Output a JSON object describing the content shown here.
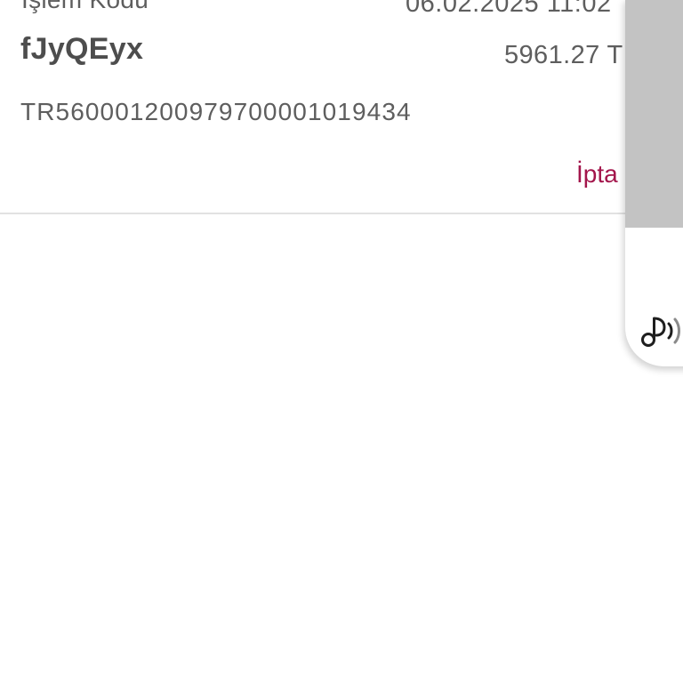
{
  "transaction": {
    "label_top": "İşlem Kodu",
    "date": "06.02.2025 11:02",
    "code": "fJyQEyx",
    "amount": "5961.27 T",
    "iban": "TR560001200979700001019434",
    "cancel_label": "İpta"
  },
  "floating_panel": {
    "icon": "music-sound-icon"
  },
  "colors": {
    "text": "#5e5e5e",
    "code_text": "#4d4d4d",
    "accent": "#a3154b",
    "divider": "#e2e2e2",
    "panel_grey": "#c3c3c3"
  }
}
